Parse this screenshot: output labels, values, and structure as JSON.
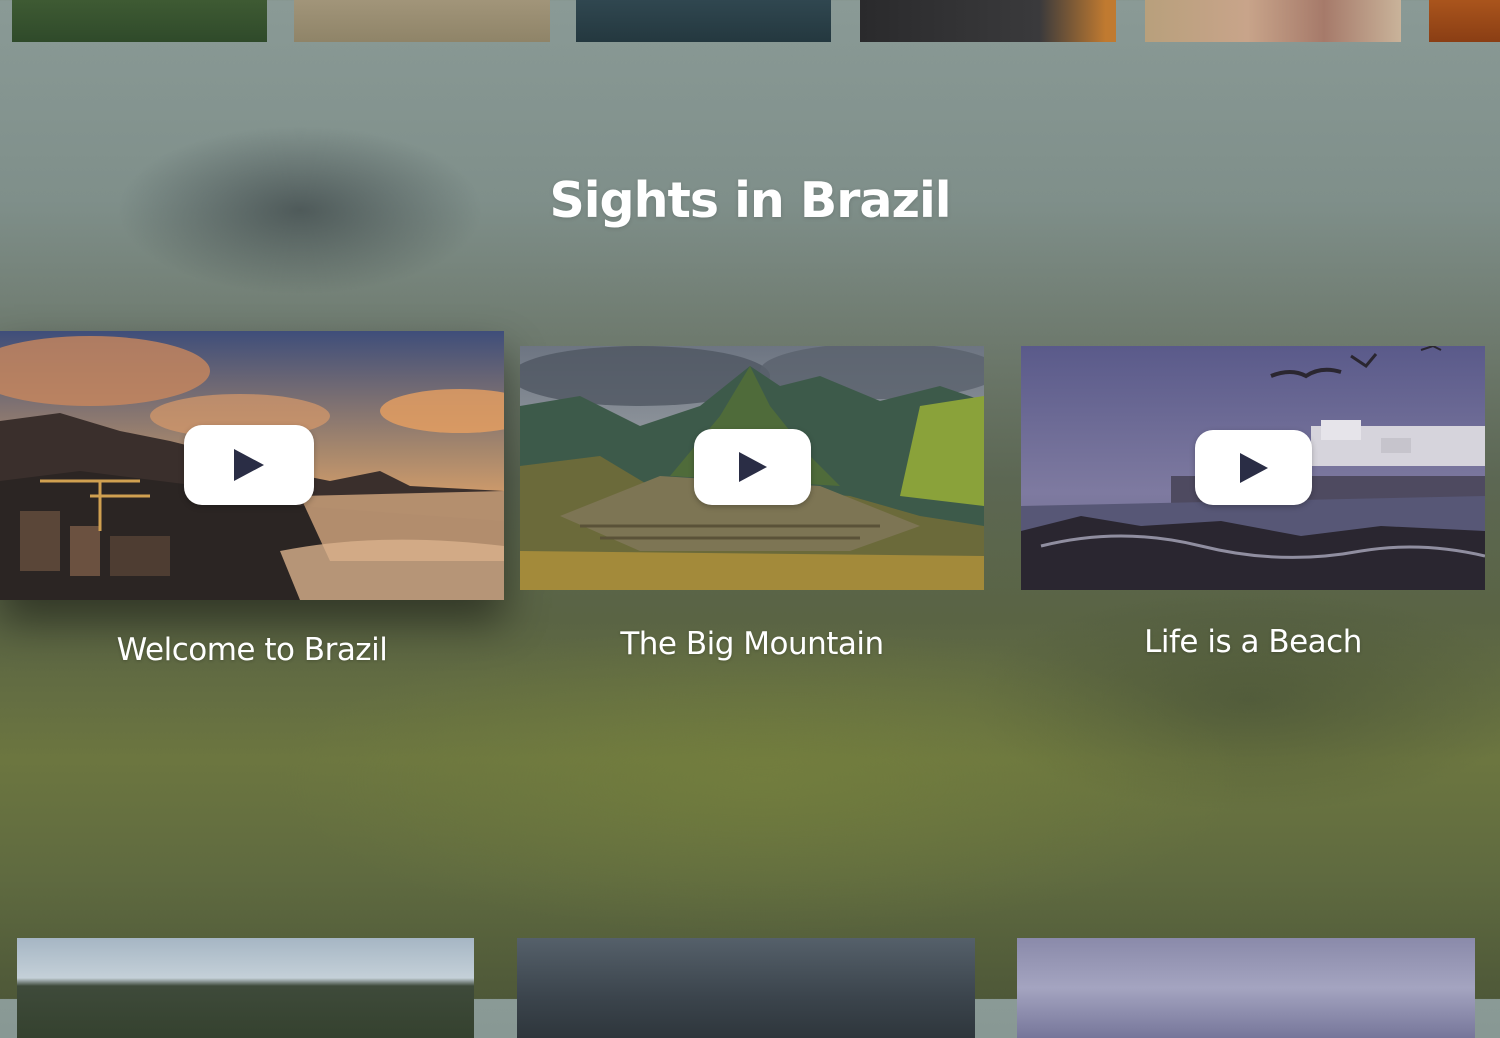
{
  "section": {
    "title": "Sights in Brazil"
  },
  "cards": [
    {
      "title": "Welcome to Brazil",
      "focused": true,
      "play_icon": "play-icon"
    },
    {
      "title": "The Big Mountain",
      "focused": false,
      "play_icon": "play-icon"
    },
    {
      "title": "Life is a Beach",
      "focused": false,
      "play_icon": "play-icon"
    }
  ],
  "colors": {
    "text": "#ffffff",
    "play_button_bg": "#ffffff",
    "play_glyph": "#2a2d45"
  }
}
